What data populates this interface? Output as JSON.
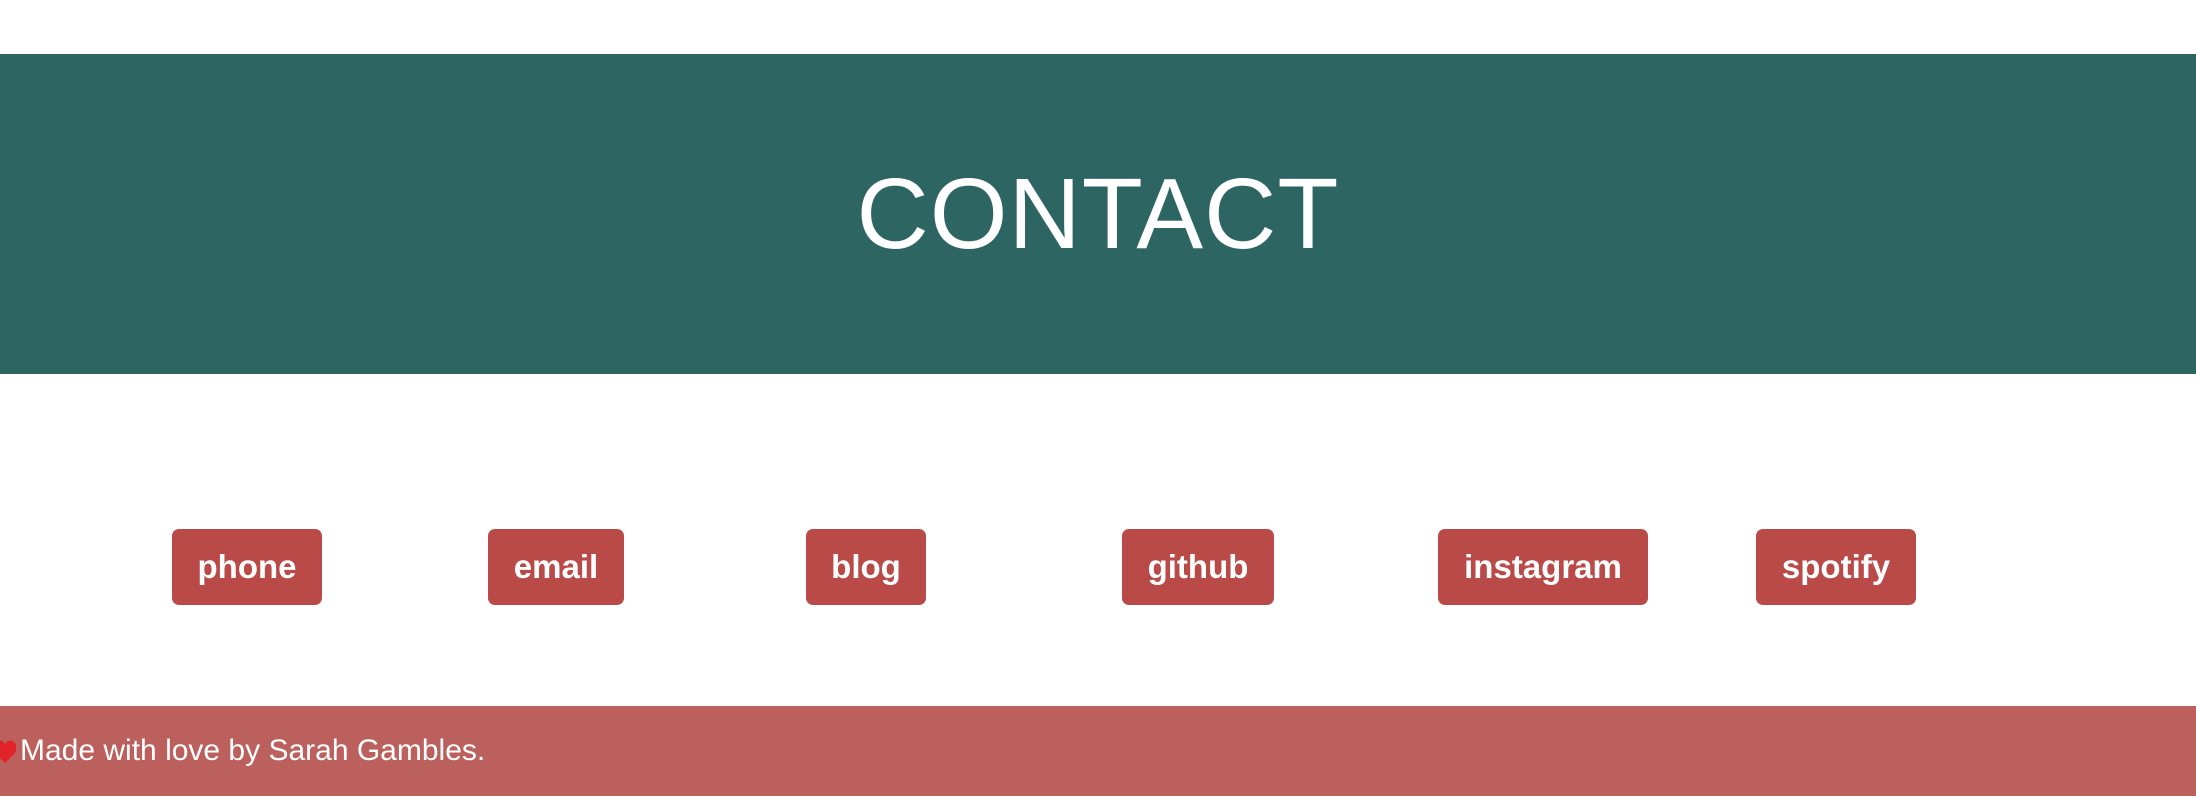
{
  "header": {
    "title": "CONTACT"
  },
  "links": [
    {
      "label": "phone"
    },
    {
      "label": "email"
    },
    {
      "label": "blog"
    },
    {
      "label": "github"
    },
    {
      "label": "instagram"
    },
    {
      "label": "spotify"
    }
  ],
  "footer": {
    "icon": "heart-icon",
    "text": "Made with love by Sarah Gambles."
  },
  "colors": {
    "hero_bg": "#2d6562",
    "button_bg": "#b94a48",
    "footer_bg": "#bb605d",
    "text": "#ffffff"
  }
}
